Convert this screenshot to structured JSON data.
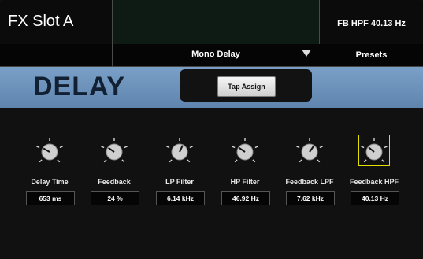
{
  "header": {
    "slot_title": "FX Slot A",
    "readout": "FB HPF   40.13 Hz",
    "effect_name": "Mono Delay",
    "presets_label": "Presets"
  },
  "banner": {
    "title": "DELAY",
    "tap_assign_label": "Tap Assign"
  },
  "knobs": [
    {
      "label": "Delay Time",
      "value": "653 ms",
      "angle_deg": -60,
      "selected": false
    },
    {
      "label": "Feedback",
      "value": "24 %",
      "angle_deg": -55,
      "selected": false
    },
    {
      "label": "LP Filter",
      "value": "6.14 kHz",
      "angle_deg": 25,
      "selected": false
    },
    {
      "label": "HP Filter",
      "value": "46.92 Hz",
      "angle_deg": -55,
      "selected": false
    },
    {
      "label": "Feedback LPF",
      "value": "7.62 kHz",
      "angle_deg": 35,
      "selected": false
    },
    {
      "label": "Feedback HPF",
      "value": "40.13 Hz",
      "angle_deg": -50,
      "selected": true
    }
  ],
  "colors": {
    "banner_blue": "#6b90b9",
    "highlight_yellow": "#e3e000"
  }
}
